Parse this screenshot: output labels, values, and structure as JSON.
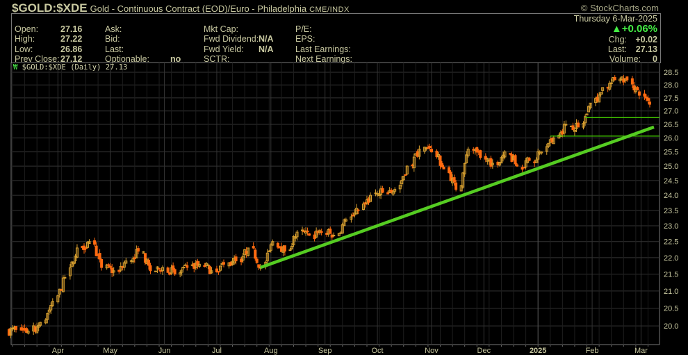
{
  "header": {
    "symbol": "$GOLD:$XDE",
    "description": "Gold - Continuous Contract (EOD)/Euro - Philadelphia",
    "exchange": "CME/INDX",
    "brand": "© StockCharts.com",
    "date": "Thursday  6-Mar-2025",
    "pct_change": "+0.06%",
    "chg_label": "Chg:",
    "chg_value": "+0.02",
    "last_label": "Last:",
    "last_value": "27.13",
    "volume_label": "Volume:",
    "volume_value": "0"
  },
  "stats": {
    "open_label": "Open:",
    "open": "27.16",
    "high_label": "High:",
    "high": "27.22",
    "low_label": "Low:",
    "low": "26.86",
    "prev_close_label": "Prev Close:",
    "prev_close": "27.12",
    "ask_label": "Ask:",
    "bid_label": "Bid:",
    "last_label": "Last:",
    "optionable_label": "Optionable:",
    "optionable": "no",
    "mkt_cap_label": "Mkt Cap:",
    "fwd_dividend_label": "Fwd Dividend:",
    "fwd_dividend": "N/A",
    "fwd_yield_label": "Fwd Yield:",
    "fwd_yield": "N/A",
    "sctr_label": "SCTR:",
    "pe_label": "P/E:",
    "eps_label": "EPS:",
    "last_earnings_label": "Last Earnings:",
    "next_earnings_label": "Next Earnings:"
  },
  "legend": "$GOLD:$XDE (Daily) 27.13",
  "colors": {
    "up": "#d8a030",
    "down": "#ff6a10",
    "trend": "#55cc22",
    "hline": "#44cc00",
    "grid": "#333333",
    "text": "#c8c8a0",
    "pct_up": "#44ee44"
  },
  "chart_data": {
    "type": "candlestick",
    "title": "$GOLD:$XDE (Daily) 27.13",
    "scale": "log",
    "ylim": [
      19.7,
      28.7
    ],
    "y_ticks": [
      "20.0",
      "20.5",
      "21.0",
      "21.5",
      "22.0",
      "22.5",
      "23.0",
      "23.5",
      "24.0",
      "24.5",
      "25.0",
      "25.5",
      "26.0",
      "26.5",
      "27.0",
      "27.5",
      "28.0",
      "28.5"
    ],
    "x_range": [
      "2024-03-06",
      "2025-03-08"
    ],
    "x_ticks": [
      {
        "label": "Apr",
        "date": "2024-04-01"
      },
      {
        "label": "May",
        "date": "2024-05-01"
      },
      {
        "label": "Jun",
        "date": "2024-06-01"
      },
      {
        "label": "Jul",
        "date": "2024-07-01"
      },
      {
        "label": "Aug",
        "date": "2024-08-01"
      },
      {
        "label": "Sep",
        "date": "2024-09-01"
      },
      {
        "label": "Oct",
        "date": "2024-10-01"
      },
      {
        "label": "Nov",
        "date": "2024-11-01"
      },
      {
        "label": "Dec",
        "date": "2024-12-01"
      },
      {
        "label": "2025",
        "date": "2025-01-01"
      },
      {
        "label": "Feb",
        "date": "2025-02-01"
      },
      {
        "label": "Mar",
        "date": "2025-03-01"
      }
    ],
    "weekly_closes": {
      "start": "2024-03-08",
      "values": [
        19.9,
        19.85,
        20.1,
        20.7,
        21.4,
        22.3,
        22.5,
        21.7,
        21.6,
        21.9,
        22.2,
        21.6,
        21.7,
        21.5,
        21.7,
        21.8,
        21.6,
        21.8,
        21.9,
        22.3,
        21.7,
        22.5,
        22.2,
        22.8,
        22.7,
        22.8,
        22.7,
        23.2,
        23.5,
        24.0,
        24.1,
        24.2,
        25.0,
        25.6,
        25.5,
        24.9,
        24.2,
        25.6,
        25.3,
        25.1,
        25.5,
        25.0,
        25.2,
        25.5,
        26.0,
        26.5,
        26.4,
        27.3,
        27.9,
        28.2,
        28.2,
        27.6,
        27.13
      ]
    },
    "trendline": {
      "from": {
        "date": "2024-07-26",
        "price": 21.7
      },
      "to": {
        "date": "2025-03-06",
        "price": 26.4
      }
    },
    "horizontal_lines": [
      {
        "from": "2025-01-28",
        "price": 26.75
      },
      {
        "from": "2025-01-08",
        "price": 26.07
      }
    ]
  }
}
